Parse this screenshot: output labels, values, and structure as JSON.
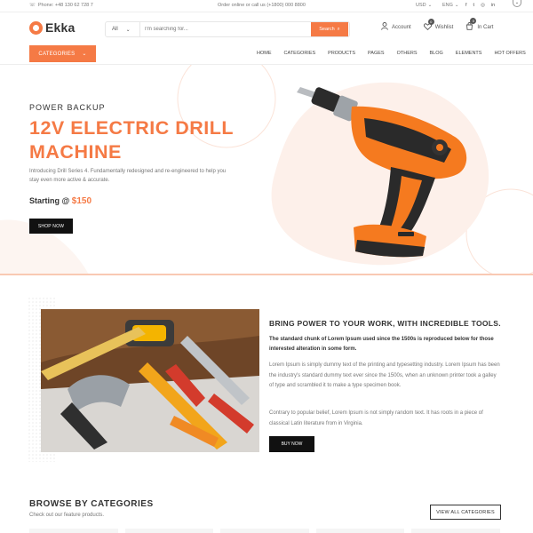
{
  "topbar": {
    "phone": "Phone: +48 130 62 728 7",
    "center": "Order online or call us (+1800) 000 8800",
    "currency": "USD",
    "language": "ENG",
    "social": [
      "f",
      "t",
      "◎",
      "in"
    ]
  },
  "header": {
    "logo": "Ekka",
    "search_category": "All",
    "search_placeholder": "I'm searching for...",
    "search_button": "Search",
    "account": "Account",
    "wishlist": "Wishlist",
    "wishlist_count": "0",
    "cart": "In Cart",
    "cart_count": "0"
  },
  "nav": {
    "categories_button": "CATEGORIES",
    "items": [
      "HOME",
      "CATEGORIES",
      "PRODUCTS",
      "PAGES",
      "OTHERS",
      "BLOG",
      "ELEMENTS",
      "HOT OFFERS"
    ]
  },
  "hero": {
    "kicker": "POWER BACKUP",
    "title": "12V ELECTRIC DRILL MACHINE",
    "description": "Introducing Drill Series 4. Fundamentally redesigned and re-engineered to help you stay even more active & accurate.",
    "price_label": "Starting @",
    "price_value": "$150",
    "cta": "SHOP NOW"
  },
  "feature": {
    "heading": "BRING POWER TO YOUR WORK, WITH INCREDIBLE TOOLS.",
    "lead": "The standard chunk of Lorem Ipsum used since the 1500s is reproduced below for those interested alteration in some form.",
    "para1": "Lorem Ipsum is simply dummy text of the printing and typesetting industry. Lorem Ipsum has been the industry's standard dummy text ever since the 1500s, when an unknown printer took a galley of type and scrambled it to make a type specimen book.",
    "para2": "Contrary to popular belief, Lorem Ipsum is not simply random text. It has roots in a piece of classical Latin literature from in Virginia.",
    "cta": "BUY NOW"
  },
  "browse": {
    "heading": "BROWSE BY CATEGORIES",
    "subheading": "Check out our feature products.",
    "view_all": "VIEW ALL CATEGORIES"
  },
  "colors": {
    "accent": "#f57a45",
    "dark": "#111111",
    "hero_bg_shape": "#fdf0ea"
  }
}
